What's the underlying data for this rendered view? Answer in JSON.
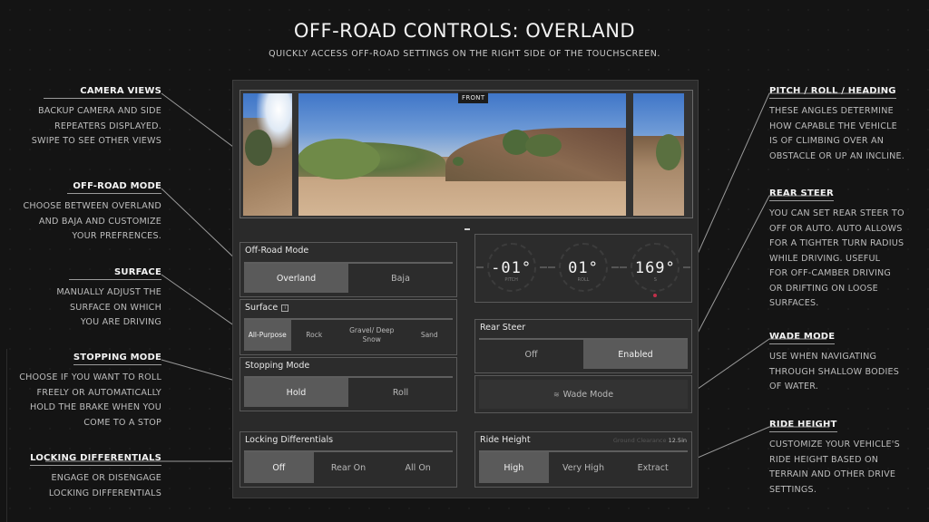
{
  "header": {
    "title": "OFF-ROAD CONTROLS: OVERLAND",
    "subtitle": "QUICKLY ACCESS OFF-ROAD SETTINGS ON THE RIGHT SIDE OF THE TOUCHSCREEN."
  },
  "callouts_left": [
    {
      "title": "CAMERA VIEWS",
      "lines": [
        "BACKUP CAMERA AND SIDE",
        "REPEATERS DISPLAYED.",
        "SWIPE TO SEE OTHER VIEWS"
      ]
    },
    {
      "title": "OFF-ROAD MODE",
      "lines": [
        "CHOOSE BETWEEN OVERLAND",
        "AND BAJA AND CUSTOMIZE",
        "YOUR PREFRENCES."
      ]
    },
    {
      "title": "SURFACE",
      "lines": [
        "MANUALLY ADJUST THE",
        "SURFACE ON WHICH",
        "YOU ARE DRIVING"
      ]
    },
    {
      "title": "STOPPING MODE",
      "lines": [
        "CHOOSE IF YOU WANT TO ROLL",
        "FREELY OR AUTOMATICALLY",
        "HOLD THE BRAKE WHEN YOU",
        "COME TO A STOP"
      ]
    },
    {
      "title": "LOCKING DIFFERENTIALS",
      "lines": [
        "ENGAGE OR DISENGAGE",
        "LOCKING DIFFERENTIALS"
      ]
    }
  ],
  "callouts_right": [
    {
      "title": "PITCH / ROLL / HEADING",
      "lines": [
        "THESE ANGLES DETERMINE",
        "HOW CAPABLE THE VEHICLE",
        "IS OF CLIMBING OVER AN",
        "OBSTACLE OR UP AN INCLINE."
      ]
    },
    {
      "title": "REAR STEER",
      "lines": [
        "YOU CAN SET REAR STEER TO",
        "OFF OR AUTO. AUTO ALLOWS",
        "FOR A TIGHTER TURN RADIUS",
        "WHILE DRIVING. USEFUL",
        "FOR OFF-CAMBER DRIVING",
        "OR DRIFTING ON LOOSE",
        "SURFACES."
      ]
    },
    {
      "title": "WADE MODE",
      "lines": [
        "USE WHEN NAVIGATING",
        "THROUGH SHALLOW BODIES",
        "OF WATER."
      ]
    },
    {
      "title": "RIDE HEIGHT",
      "lines": [
        "CUSTOMIZE YOUR VEHICLE'S",
        "RIDE HEIGHT BASED ON",
        "TERRAIN AND OTHER DRIVE",
        "SETTINGS."
      ]
    }
  ],
  "screen": {
    "camera": {
      "label": "FRONT",
      "views": [
        "left-repeater",
        "front",
        "right-repeater"
      ]
    },
    "offroad_mode": {
      "title": "Off-Road Mode",
      "options": [
        "Overland",
        "Baja"
      ],
      "selected": "Overland"
    },
    "surface": {
      "title": "Surface",
      "info_icon": "info-icon",
      "options": [
        "All-Purpose",
        "Rock",
        "Gravel/ Deep Snow",
        "Sand"
      ],
      "selected": "All-Purpose"
    },
    "stopping_mode": {
      "title": "Stopping Mode",
      "options": [
        "Hold",
        "Roll"
      ],
      "selected": "Hold"
    },
    "locking_differentials": {
      "title": "Locking Differentials",
      "options": [
        "Off",
        "Rear On",
        "All On"
      ],
      "selected": "Off"
    },
    "gauges": [
      {
        "name": "pitch",
        "value": "-01°",
        "label": "PITCH"
      },
      {
        "name": "roll",
        "value": "01°",
        "label": "ROLL"
      },
      {
        "name": "heading",
        "value": "169°",
        "label": "S"
      }
    ],
    "rear_steer": {
      "title": "Rear Steer",
      "options": [
        "Off",
        "Enabled"
      ],
      "selected": "Enabled"
    },
    "wade_mode": {
      "label": "Wade Mode",
      "icon": "wave-icon"
    },
    "ride_height": {
      "title": "Ride Height",
      "info_label": "Ground Clearance",
      "info_value": "12.5in",
      "options": [
        "High",
        "Very High",
        "Extract"
      ],
      "selected": "High"
    }
  }
}
